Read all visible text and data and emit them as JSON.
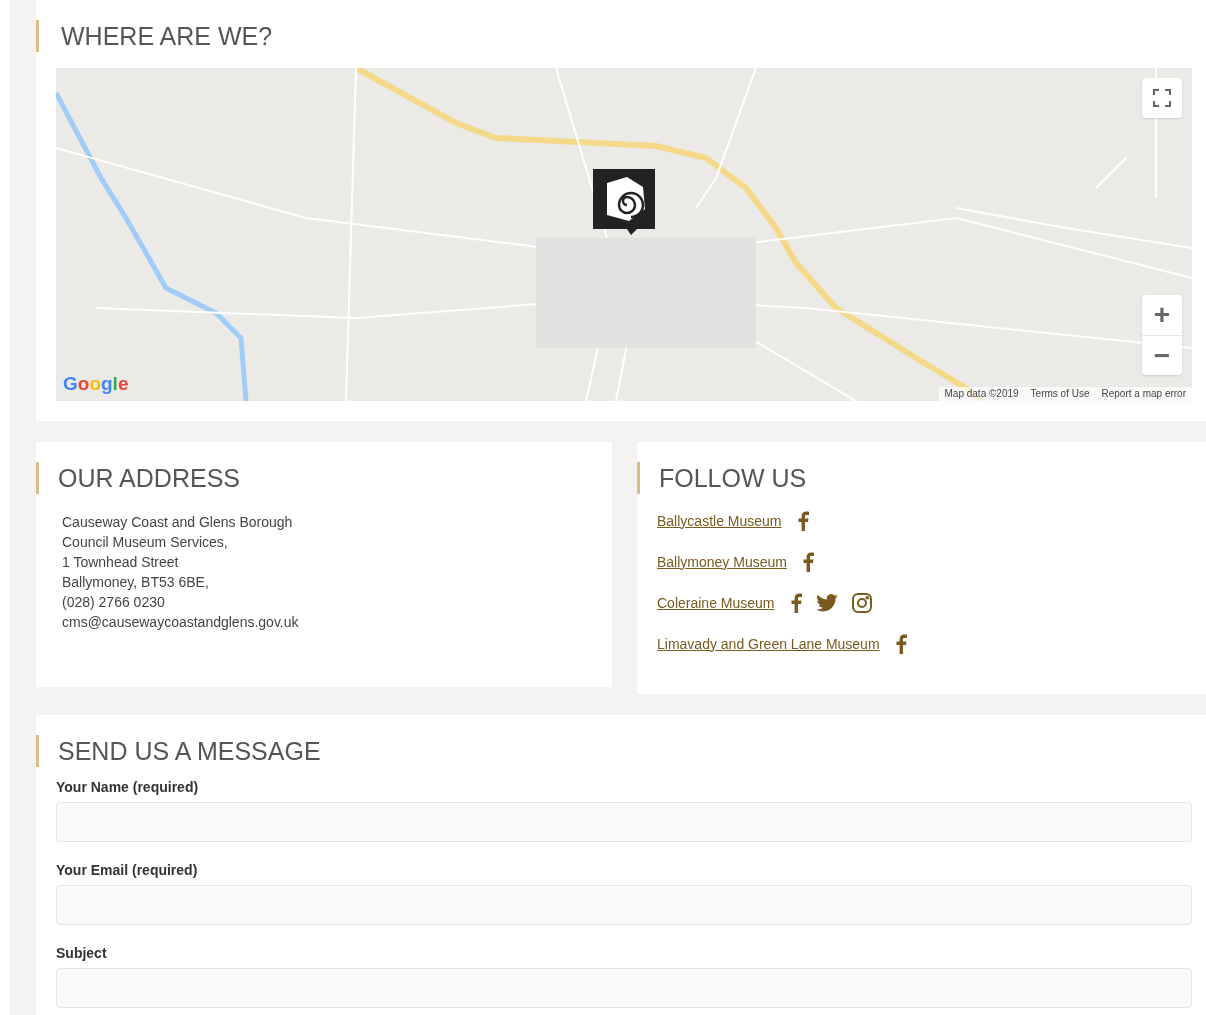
{
  "location": {
    "heading": "WHERE ARE WE?",
    "map": {
      "logo": "Google",
      "attribution": [
        "Map data ©2019",
        "Terms of Use",
        "Report a map error"
      ],
      "zoom_in": "+",
      "zoom_out": "−"
    }
  },
  "address": {
    "heading": "OUR ADDRESS",
    "lines": [
      "Causeway Coast and Glens Borough",
      "Council Museum Services,",
      "1 Townhead Street",
      "Ballymoney, BT53 6BE,",
      "(028) 2766 0230",
      "cms@causewaycoastandglens.gov.uk"
    ]
  },
  "follow": {
    "heading": "FOLLOW US",
    "museums": [
      {
        "name": "Ballycastle Museum",
        "networks": [
          {
            "kind": "facebook"
          }
        ]
      },
      {
        "name": "Ballymoney Museum",
        "networks": [
          {
            "kind": "facebook"
          }
        ]
      },
      {
        "name": "Coleraine Museum",
        "networks": [
          {
            "kind": "facebook"
          },
          {
            "kind": "twitter"
          },
          {
            "kind": "instagram"
          }
        ]
      },
      {
        "name": "Limavady and Green Lane Museum",
        "networks": [
          {
            "kind": "facebook"
          }
        ]
      }
    ]
  },
  "message": {
    "heading": "SEND US A MESSAGE",
    "fields": [
      {
        "label": "Your Name (required)"
      },
      {
        "label": "Your Email (required)"
      },
      {
        "label": "Subject"
      }
    ]
  }
}
